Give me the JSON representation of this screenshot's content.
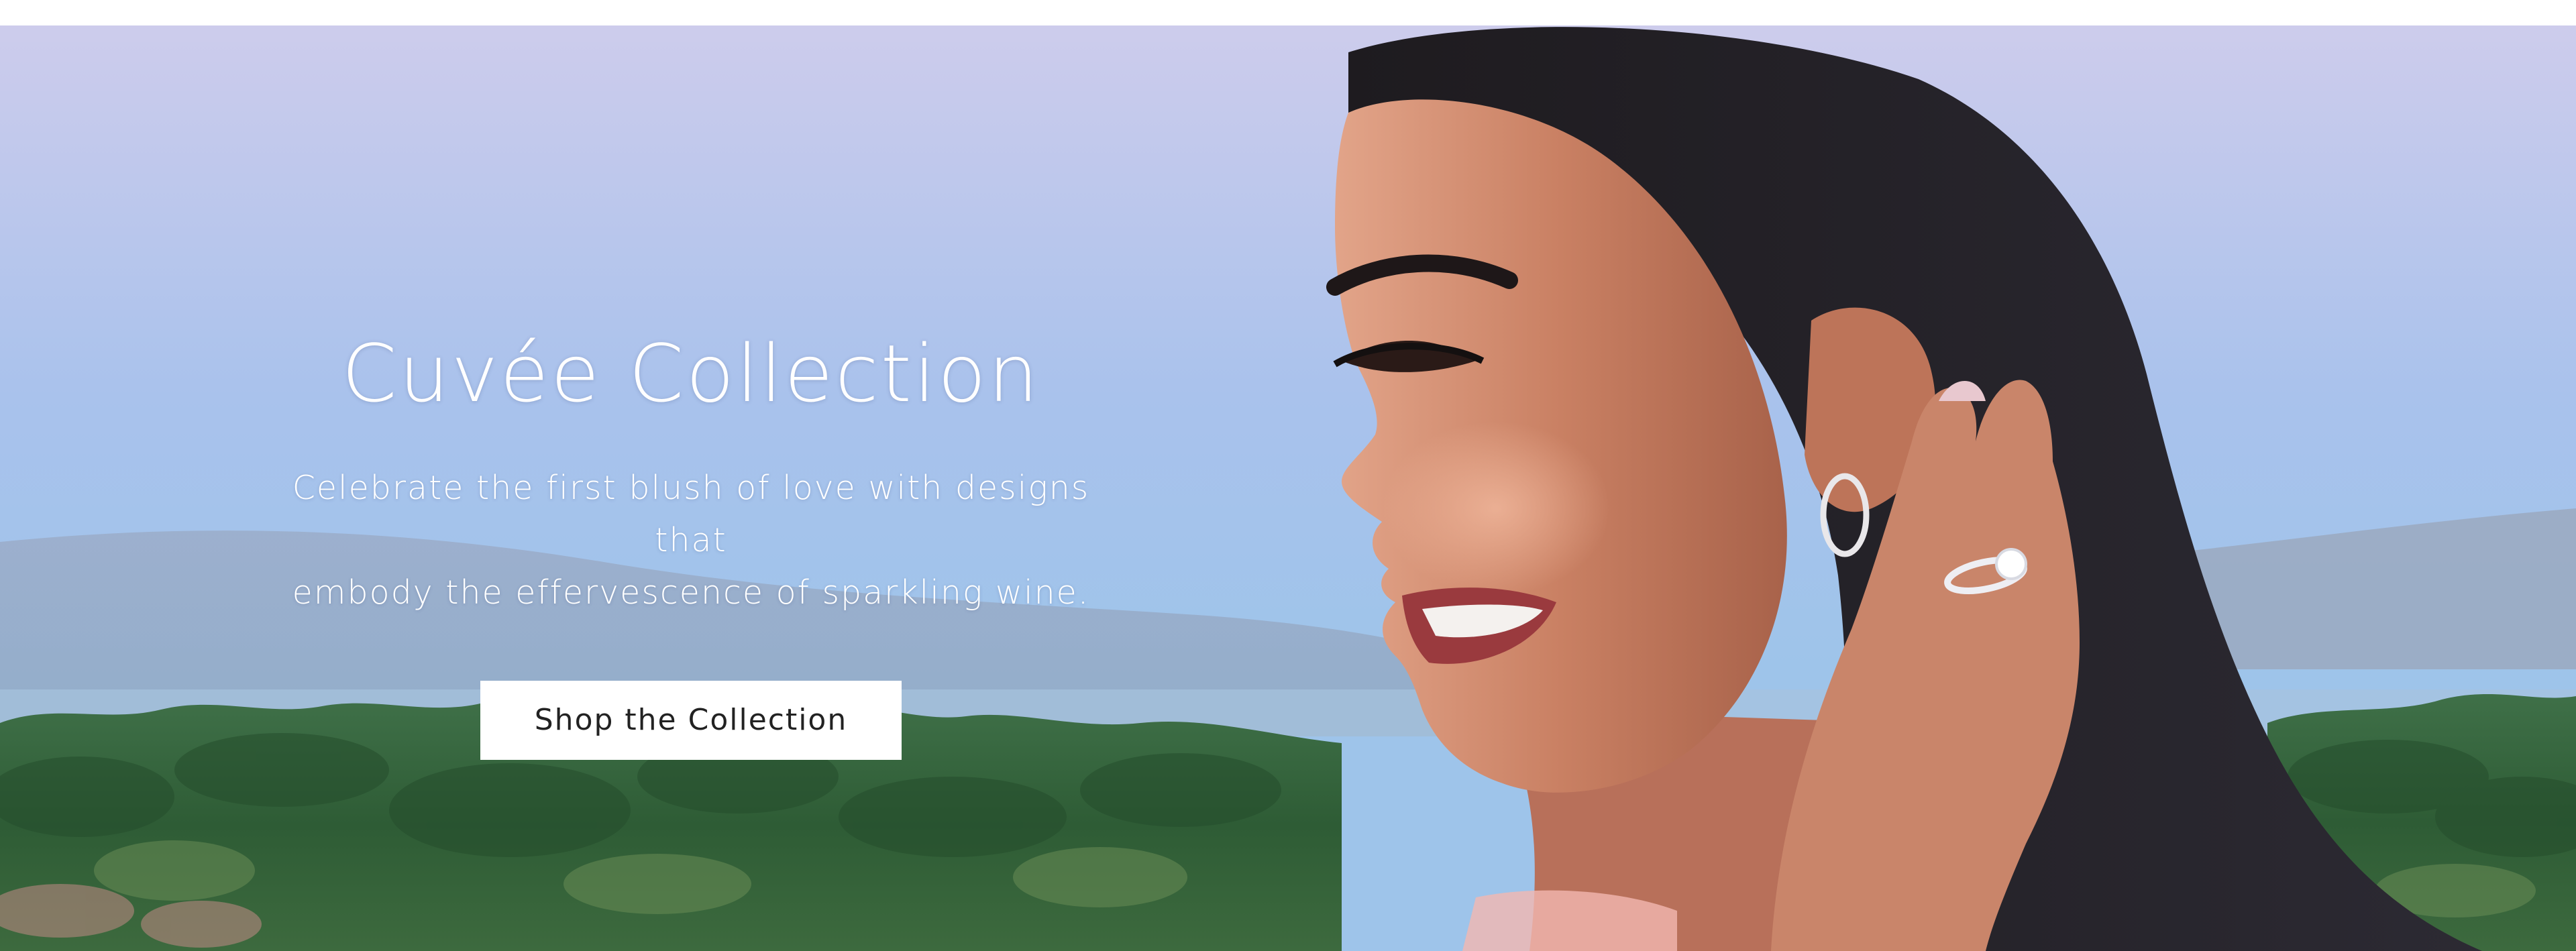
{
  "hero": {
    "title": "Cuvée Collection",
    "subtitle_line1": "Celebrate the first blush of love with designs that",
    "subtitle_line2": "embody the effervescence of sparkling wine.",
    "cta_label": "Shop the Collection"
  },
  "colors": {
    "sky": "#b3c3ea",
    "foliage": "#3c6b45",
    "text": "#ffffff",
    "button_bg": "#ffffff",
    "button_text": "#222222"
  }
}
